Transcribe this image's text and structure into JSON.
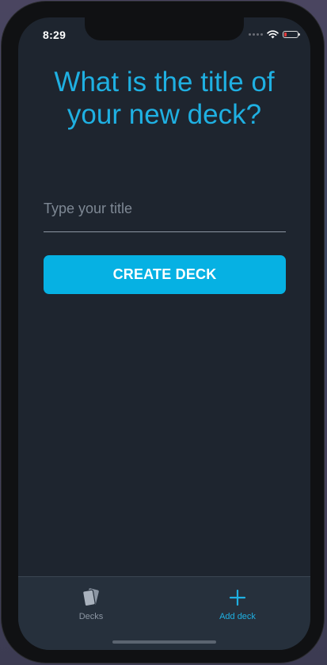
{
  "status_bar": {
    "time": "8:29",
    "battery_level": 0.15,
    "battery_color": "#e33b3b"
  },
  "new_deck": {
    "heading": "What is the title of your new deck?",
    "title_input": {
      "value": "",
      "placeholder": "Type your title"
    },
    "create_button_label": "CREATE DECK"
  },
  "tab_bar": {
    "active_tab": "add-deck",
    "tabs": [
      {
        "label": "Decks",
        "icon": "cards-icon",
        "color": "#8c96a3"
      },
      {
        "label": "Add deck",
        "icon": "plus-icon",
        "color": "#1fb0e2"
      }
    ]
  },
  "colors": {
    "accent": "#06b1e3",
    "background": "#1e252f",
    "tab_bar": "#26303c"
  }
}
